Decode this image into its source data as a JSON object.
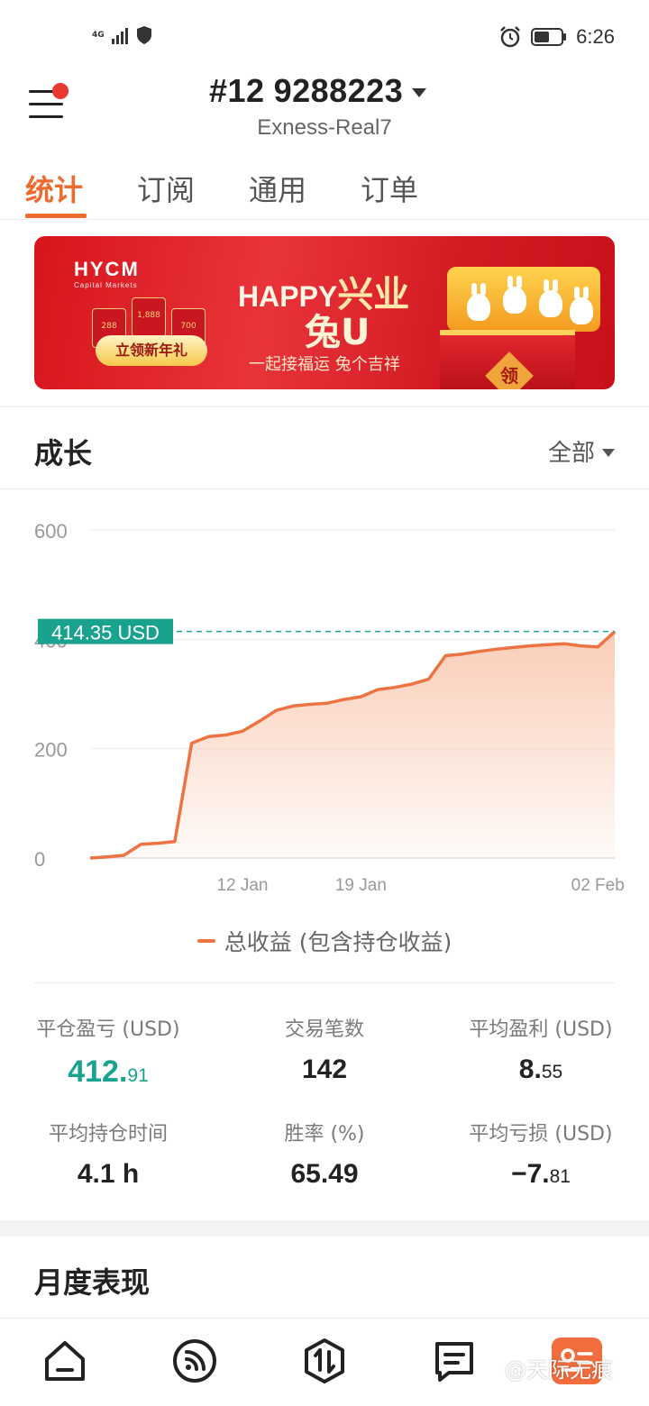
{
  "status_bar": {
    "network": "4G",
    "time": "6:26"
  },
  "header": {
    "account_prefix": "#12",
    "account_number": "9288223",
    "server": "Exness-Real7"
  },
  "tabs": [
    {
      "label": "统计",
      "active": true
    },
    {
      "label": "订阅",
      "active": false
    },
    {
      "label": "通用",
      "active": false
    },
    {
      "label": "订单",
      "active": false
    }
  ],
  "banner": {
    "brand": "HYCM",
    "brand_sub": "Capital Markets",
    "envelopes": [
      "288",
      "1,888",
      "700"
    ],
    "button": "立领新年礼",
    "headline_en": "HAPPY",
    "headline_cn": "兴业",
    "headline_2": "兔U",
    "slogan": "一起接福运 兔个吉祥",
    "box_label": "领"
  },
  "growth": {
    "title": "成长",
    "range": "全部",
    "legend": "总收益 (包含持仓收益)",
    "current_label": "414.35 USD"
  },
  "chart_data": {
    "type": "area",
    "x": [
      "Jan 03",
      "Jan 04",
      "Jan 05",
      "Jan 06",
      "Jan 07",
      "Jan 08",
      "Jan 09",
      "Jan 10",
      "Jan 11",
      "Jan 12",
      "Jan 13",
      "Jan 14",
      "Jan 15",
      "Jan 16",
      "Jan 17",
      "Jan 18",
      "Jan 19",
      "Jan 20",
      "Jan 21",
      "Jan 22",
      "Jan 23",
      "Jan 24",
      "Jan 25",
      "Jan 26",
      "Jan 27",
      "Jan 28",
      "Jan 29",
      "Jan 30",
      "Jan 31",
      "Feb 01",
      "Feb 02",
      "Feb 03"
    ],
    "series": [
      {
        "name": "总收益 (包含持仓收益)",
        "values": [
          0,
          2,
          5,
          25,
          27,
          30,
          210,
          222,
          225,
          232,
          250,
          270,
          278,
          281,
          283,
          290,
          295,
          308,
          312,
          318,
          327,
          370,
          373,
          378,
          382,
          385,
          388,
          390,
          392,
          388,
          386,
          414
        ]
      }
    ],
    "ylim": [
      0,
      600
    ],
    "yticks": [
      0,
      200,
      400,
      600
    ],
    "xticks": [
      "12 Jan",
      "19 Jan",
      "02 Feb"
    ],
    "grid": true,
    "current_value": 414.35,
    "current_label": "414.35 USD",
    "colors": {
      "line": "#ee7342",
      "fill": "#f9c4aa",
      "marker": "#19a38e"
    }
  },
  "stats": [
    {
      "label": "平仓盈亏 (USD)",
      "value_main": "412.",
      "value_small": "91",
      "color": "green"
    },
    {
      "label": "交易笔数",
      "value_main": "142",
      "value_small": ""
    },
    {
      "label": "平均盈利 (USD)",
      "value_main": "8.",
      "value_small": "55"
    },
    {
      "label": "平均持仓时间",
      "value_main": "4.1 h",
      "value_small": ""
    },
    {
      "label": "胜率 (%)",
      "value_main": "65.49",
      "value_small": ""
    },
    {
      "label": "平均亏损 (USD)",
      "value_main": "−7.",
      "value_small": "81"
    }
  ],
  "monthly": {
    "title": "月度表现"
  },
  "nav": {
    "items": [
      "home-icon",
      "feed-icon",
      "trade-icon",
      "news-icon",
      "account-icon"
    ],
    "watermark": "@天际无痕"
  },
  "colors": {
    "accent": "#ee6a2e",
    "profit": "#19a38e"
  }
}
